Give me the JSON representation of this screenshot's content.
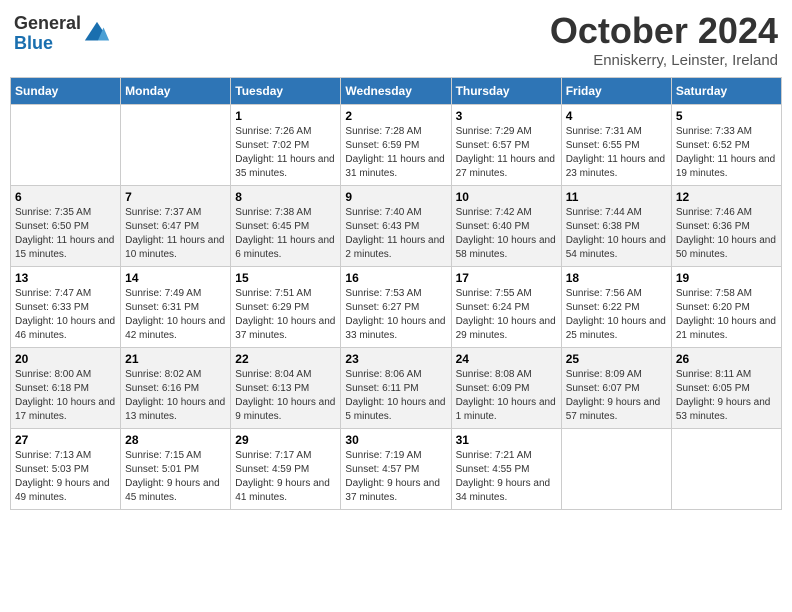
{
  "logo": {
    "general": "General",
    "blue": "Blue"
  },
  "header": {
    "month": "October 2024",
    "location": "Enniskerry, Leinster, Ireland"
  },
  "days_of_week": [
    "Sunday",
    "Monday",
    "Tuesday",
    "Wednesday",
    "Thursday",
    "Friday",
    "Saturday"
  ],
  "weeks": [
    [
      {
        "day": "",
        "sunrise": "",
        "sunset": "",
        "daylight": ""
      },
      {
        "day": "",
        "sunrise": "",
        "sunset": "",
        "daylight": ""
      },
      {
        "day": "1",
        "sunrise": "Sunrise: 7:26 AM",
        "sunset": "Sunset: 7:02 PM",
        "daylight": "Daylight: 11 hours and 35 minutes."
      },
      {
        "day": "2",
        "sunrise": "Sunrise: 7:28 AM",
        "sunset": "Sunset: 6:59 PM",
        "daylight": "Daylight: 11 hours and 31 minutes."
      },
      {
        "day": "3",
        "sunrise": "Sunrise: 7:29 AM",
        "sunset": "Sunset: 6:57 PM",
        "daylight": "Daylight: 11 hours and 27 minutes."
      },
      {
        "day": "4",
        "sunrise": "Sunrise: 7:31 AM",
        "sunset": "Sunset: 6:55 PM",
        "daylight": "Daylight: 11 hours and 23 minutes."
      },
      {
        "day": "5",
        "sunrise": "Sunrise: 7:33 AM",
        "sunset": "Sunset: 6:52 PM",
        "daylight": "Daylight: 11 hours and 19 minutes."
      }
    ],
    [
      {
        "day": "6",
        "sunrise": "Sunrise: 7:35 AM",
        "sunset": "Sunset: 6:50 PM",
        "daylight": "Daylight: 11 hours and 15 minutes."
      },
      {
        "day": "7",
        "sunrise": "Sunrise: 7:37 AM",
        "sunset": "Sunset: 6:47 PM",
        "daylight": "Daylight: 11 hours and 10 minutes."
      },
      {
        "day": "8",
        "sunrise": "Sunrise: 7:38 AM",
        "sunset": "Sunset: 6:45 PM",
        "daylight": "Daylight: 11 hours and 6 minutes."
      },
      {
        "day": "9",
        "sunrise": "Sunrise: 7:40 AM",
        "sunset": "Sunset: 6:43 PM",
        "daylight": "Daylight: 11 hours and 2 minutes."
      },
      {
        "day": "10",
        "sunrise": "Sunrise: 7:42 AM",
        "sunset": "Sunset: 6:40 PM",
        "daylight": "Daylight: 10 hours and 58 minutes."
      },
      {
        "day": "11",
        "sunrise": "Sunrise: 7:44 AM",
        "sunset": "Sunset: 6:38 PM",
        "daylight": "Daylight: 10 hours and 54 minutes."
      },
      {
        "day": "12",
        "sunrise": "Sunrise: 7:46 AM",
        "sunset": "Sunset: 6:36 PM",
        "daylight": "Daylight: 10 hours and 50 minutes."
      }
    ],
    [
      {
        "day": "13",
        "sunrise": "Sunrise: 7:47 AM",
        "sunset": "Sunset: 6:33 PM",
        "daylight": "Daylight: 10 hours and 46 minutes."
      },
      {
        "day": "14",
        "sunrise": "Sunrise: 7:49 AM",
        "sunset": "Sunset: 6:31 PM",
        "daylight": "Daylight: 10 hours and 42 minutes."
      },
      {
        "day": "15",
        "sunrise": "Sunrise: 7:51 AM",
        "sunset": "Sunset: 6:29 PM",
        "daylight": "Daylight: 10 hours and 37 minutes."
      },
      {
        "day": "16",
        "sunrise": "Sunrise: 7:53 AM",
        "sunset": "Sunset: 6:27 PM",
        "daylight": "Daylight: 10 hours and 33 minutes."
      },
      {
        "day": "17",
        "sunrise": "Sunrise: 7:55 AM",
        "sunset": "Sunset: 6:24 PM",
        "daylight": "Daylight: 10 hours and 29 minutes."
      },
      {
        "day": "18",
        "sunrise": "Sunrise: 7:56 AM",
        "sunset": "Sunset: 6:22 PM",
        "daylight": "Daylight: 10 hours and 25 minutes."
      },
      {
        "day": "19",
        "sunrise": "Sunrise: 7:58 AM",
        "sunset": "Sunset: 6:20 PM",
        "daylight": "Daylight: 10 hours and 21 minutes."
      }
    ],
    [
      {
        "day": "20",
        "sunrise": "Sunrise: 8:00 AM",
        "sunset": "Sunset: 6:18 PM",
        "daylight": "Daylight: 10 hours and 17 minutes."
      },
      {
        "day": "21",
        "sunrise": "Sunrise: 8:02 AM",
        "sunset": "Sunset: 6:16 PM",
        "daylight": "Daylight: 10 hours and 13 minutes."
      },
      {
        "day": "22",
        "sunrise": "Sunrise: 8:04 AM",
        "sunset": "Sunset: 6:13 PM",
        "daylight": "Daylight: 10 hours and 9 minutes."
      },
      {
        "day": "23",
        "sunrise": "Sunrise: 8:06 AM",
        "sunset": "Sunset: 6:11 PM",
        "daylight": "Daylight: 10 hours and 5 minutes."
      },
      {
        "day": "24",
        "sunrise": "Sunrise: 8:08 AM",
        "sunset": "Sunset: 6:09 PM",
        "daylight": "Daylight: 10 hours and 1 minute."
      },
      {
        "day": "25",
        "sunrise": "Sunrise: 8:09 AM",
        "sunset": "Sunset: 6:07 PM",
        "daylight": "Daylight: 9 hours and 57 minutes."
      },
      {
        "day": "26",
        "sunrise": "Sunrise: 8:11 AM",
        "sunset": "Sunset: 6:05 PM",
        "daylight": "Daylight: 9 hours and 53 minutes."
      }
    ],
    [
      {
        "day": "27",
        "sunrise": "Sunrise: 7:13 AM",
        "sunset": "Sunset: 5:03 PM",
        "daylight": "Daylight: 9 hours and 49 minutes."
      },
      {
        "day": "28",
        "sunrise": "Sunrise: 7:15 AM",
        "sunset": "Sunset: 5:01 PM",
        "daylight": "Daylight: 9 hours and 45 minutes."
      },
      {
        "day": "29",
        "sunrise": "Sunrise: 7:17 AM",
        "sunset": "Sunset: 4:59 PM",
        "daylight": "Daylight: 9 hours and 41 minutes."
      },
      {
        "day": "30",
        "sunrise": "Sunrise: 7:19 AM",
        "sunset": "Sunset: 4:57 PM",
        "daylight": "Daylight: 9 hours and 37 minutes."
      },
      {
        "day": "31",
        "sunrise": "Sunrise: 7:21 AM",
        "sunset": "Sunset: 4:55 PM",
        "daylight": "Daylight: 9 hours and 34 minutes."
      },
      {
        "day": "",
        "sunrise": "",
        "sunset": "",
        "daylight": ""
      },
      {
        "day": "",
        "sunrise": "",
        "sunset": "",
        "daylight": ""
      }
    ]
  ]
}
